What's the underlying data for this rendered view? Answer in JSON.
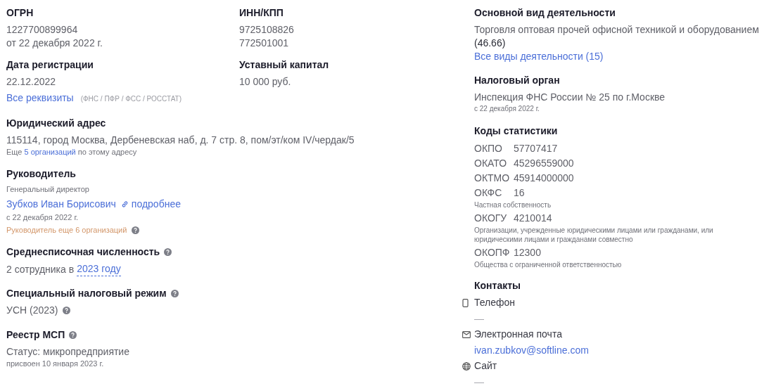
{
  "requisites": {
    "ogrn": {
      "label": "ОГРН",
      "value": "1227700899964",
      "date": "от 22 декабря 2022 г."
    },
    "inn_kpp": {
      "label": "ИНН/КПП",
      "inn": "9725108826",
      "kpp": "772501001"
    },
    "registration": {
      "label": "Дата регистрации",
      "value": "22.12.2022"
    },
    "capital": {
      "label": "Уставный капитал",
      "value": "10 000 руб."
    },
    "all_link": "Все реквизиты",
    "sources": "(ФНС / ПФР / ФСС / РОССТАТ)"
  },
  "address": {
    "label": "Юридический адрес",
    "value": "115114, город Москва, Дербеневская наб, д. 7 стр. 8, пом/эт/ком IV/чердак/5",
    "note_prefix": "Еще",
    "note_link": "5 организаций",
    "note_suffix": "по этому адресу"
  },
  "director": {
    "label": "Руководитель",
    "position": "Генеральный директор",
    "name": "Зубков Иван Борисович",
    "more": "подробнее",
    "since": "с 22 декабря 2022 г.",
    "other": "Руководитель еще 6 организаций",
    "help": true
  },
  "headcount": {
    "label": "Среднесписочная численность",
    "help": true,
    "prefix": "2 сотрудника в",
    "link": "2023 году"
  },
  "tax_regime": {
    "label": "Специальный налоговый режим",
    "help": true,
    "value": "УСН (2023)",
    "value_help": true
  },
  "msp": {
    "label": "Реестр МСП",
    "help": true,
    "status": "Статус: микропредприятие",
    "assigned": "присвоен 10 января 2023 г."
  },
  "activity": {
    "label": "Основной вид деятельности",
    "value": "Торговля оптовая прочей офисной техникой и оборудованием",
    "code": "(46.66)",
    "link": "Все виды деятельности (15)"
  },
  "tax_office": {
    "label": "Налоговый орган",
    "value": "Инспекция ФНС России № 25 по г.Москве",
    "since": "с 22 декабря 2022 г."
  },
  "stats": {
    "label": "Коды статистики",
    "codes": [
      {
        "code": "ОКПО",
        "value": "57707417"
      },
      {
        "code": "ОКАТО",
        "value": "45296559000"
      },
      {
        "code": "ОКТМО",
        "value": "45914000000"
      },
      {
        "code": "ОКФС",
        "value": "16",
        "note": "Частная собственность"
      },
      {
        "code": "ОКОГУ",
        "value": "4210014",
        "note": "Организации, учрежденные юридическими лицами или гражданами, или юридическими лицами и гражданами совместно"
      },
      {
        "code": "ОКОПФ",
        "value": "12300",
        "note": "Общества с ограниченной ответственностью"
      }
    ]
  },
  "contacts": {
    "label": "Контакты",
    "items": [
      {
        "kind": "phone",
        "label": "Телефон",
        "value": "—",
        "is_link": false
      },
      {
        "kind": "email",
        "label": "Электронная почта",
        "value": "ivan.zubkov@softline.com",
        "is_link": true
      },
      {
        "kind": "site",
        "label": "Сайт",
        "value": "—",
        "is_link": false
      }
    ]
  }
}
